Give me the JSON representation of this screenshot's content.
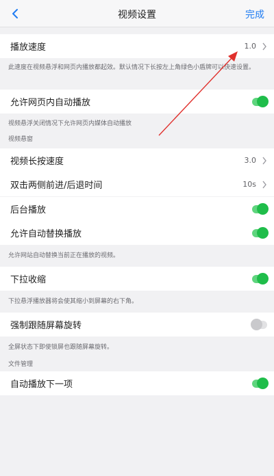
{
  "header": {
    "back_icon": "chevron-left-icon",
    "title": "视频设置",
    "done_label": "完成"
  },
  "rows": {
    "playback_speed": {
      "label": "播放速度",
      "value": "1.0"
    },
    "webpage_autoplay": {
      "label": "允许网页内自动播放",
      "on": true
    },
    "long_press_speed": {
      "label": "视频长按速度",
      "value": "3.0"
    },
    "double_tap_seek": {
      "label": "双击两侧前进/后退时间",
      "value": "10s"
    },
    "background_play": {
      "label": "后台播放",
      "on": true
    },
    "auto_replace_play": {
      "label": "允许自动替换播放",
      "on": true
    },
    "pull_down_shrink": {
      "label": "下拉收缩",
      "on": true
    },
    "force_rotate": {
      "label": "强制跟随屏幕旋转",
      "on": false
    },
    "autoplay_next": {
      "label": "自动播放下一项",
      "on": true
    }
  },
  "notes": {
    "speed_note": "此速度在视频悬浮和网页内播放都起效。默认情况下长按左上角绿色小盾牌可以快速设置。",
    "autoplay_note": "视频悬浮关闭情况下允许网页内媒体自动播放",
    "replace_note": "允许网站自动替换当前正在播放的视频。",
    "shrink_note": "下拉悬浮播放器将会使其缩小到屏幕的右下角。",
    "rotate_note": "全屏状态下即使锁屏也跟随屏幕旋转。"
  },
  "sections": {
    "floating": "视频悬窗",
    "file": "文件管理"
  },
  "colors": {
    "accent": "#1f7cf2",
    "toggle_on": "#1fbd4a",
    "arrow": "#e0302c"
  }
}
